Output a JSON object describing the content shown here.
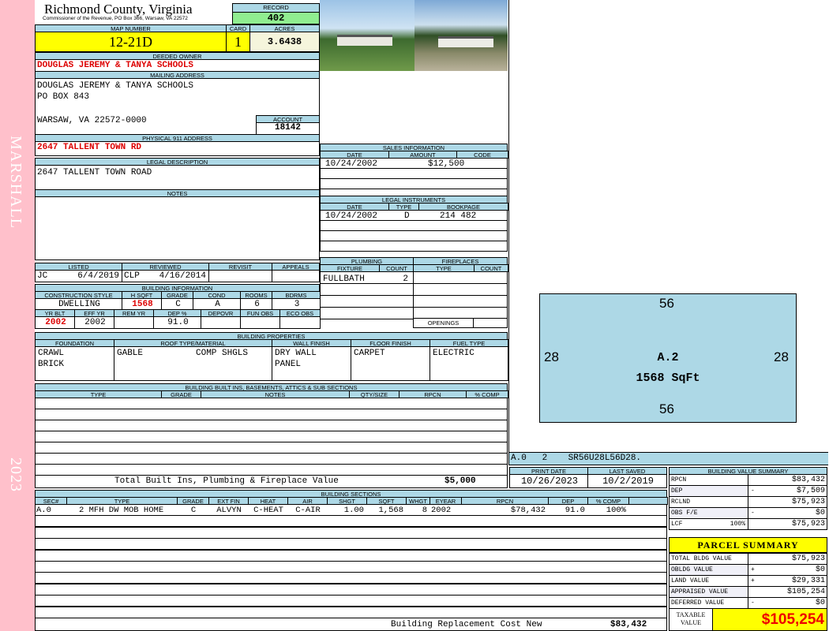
{
  "side": {
    "name": "MARSHALL",
    "year": "2023"
  },
  "header": {
    "county": "Richmond County, Virginia",
    "subtitle": "Commissioner of the Revenue, PO Box 366, Warsaw, VA 22572",
    "record_label": "RECORD",
    "record": "402"
  },
  "map": {
    "map_label": "MAP NUMBER",
    "map": "12-21D",
    "card_label": "CARD",
    "card": "1",
    "acres_label": "ACRES",
    "acres": "3.6438"
  },
  "owner": {
    "label": "DEEDED OWNER",
    "value": "DOUGLAS JEREMY & TANYA SCHOOLS"
  },
  "mailing": {
    "label": "MAILING ADDRESS",
    "line1": "DOUGLAS JEREMY & TANYA SCHOOLS",
    "line2": "PO BOX 843",
    "line3": "WARSAW, VA 22572-0000",
    "account_label": "ACCOUNT",
    "account": "18142"
  },
  "physical": {
    "label": "PHYSICAL 911 ADDRESS",
    "value": "2647 TALLENT TOWN RD"
  },
  "legal": {
    "label": "LEGAL DESCRIPTION",
    "value": "2647 TALLENT TOWN ROAD"
  },
  "notes": {
    "label": "NOTES"
  },
  "review": {
    "listed_label": "LISTED",
    "reviewed_label": "REVIEWED",
    "revisit_label": "REVISIT",
    "appeals_label": "APPEALS",
    "listed_by": "JC",
    "listed_date": "6/4/2019",
    "reviewed_by": "CLP",
    "reviewed_date": "4/16/2014"
  },
  "building_info": {
    "label": "BUILDING INFORMATION",
    "h1": [
      "CONSTRUCTION STYLE",
      "H SQFT",
      "GRADE",
      "COND",
      "ROOMS",
      "BDRMS"
    ],
    "v1": [
      "DWELLING",
      "1568",
      "C",
      "A",
      "6",
      "3"
    ],
    "h2": [
      "YR BLT",
      "EFF YR",
      "REM YR",
      "DEP %",
      "DEPOVR",
      "FUN OBS",
      "ECO OBS"
    ],
    "v2": [
      "2002",
      "2002",
      "",
      "91.0",
      "",
      "",
      ""
    ]
  },
  "sales": {
    "label": "SALES INFORMATION",
    "cols": [
      "DATE",
      "AMOUNT",
      "CODE"
    ],
    "rows": [
      [
        "10/24/2002",
        "$12,500",
        ""
      ]
    ]
  },
  "instruments": {
    "label": "LEGAL INSTRUMENTS",
    "cols": [
      "DATE",
      "TYPE",
      "BOOKPAGE"
    ],
    "rows": [
      [
        "10/24/2002",
        "D",
        "214 482"
      ]
    ]
  },
  "plumbing": {
    "label": "PLUMBING",
    "cols": [
      "FIXTURE",
      "COUNT"
    ],
    "rows": [
      [
        "FULLBATH",
        "2"
      ]
    ]
  },
  "fireplaces": {
    "label": "FIREPLACES",
    "cols": [
      "TYPE",
      "COUNT"
    ],
    "openings": "OPENINGS"
  },
  "properties": {
    "label": "BUILDING PROPERTIES",
    "cols": [
      "FOUNDATION",
      "ROOF TYPE/MATERIAL",
      "WALL FINISH",
      "FLOOR FINISH",
      "FUEL TYPE"
    ],
    "foundation": [
      "CRAWL",
      "BRICK"
    ],
    "roof_type": "GABLE",
    "roof_material": "COMP SHGLS",
    "wall": [
      "DRY WALL",
      "PANEL"
    ],
    "floor": "CARPET",
    "fuel": "ELECTRIC"
  },
  "builtins": {
    "label": "BUILDING BUILT INS, BASEMENTS, ATTICS & SUB SECTIONS",
    "cols": [
      "TYPE",
      "GRADE",
      "NOTES",
      "QTY/SIZE",
      "RPCN",
      "% COMP"
    ],
    "total_label": "Total Built Ins, Plumbing & Fireplace Value",
    "total": "$5,000"
  },
  "sketch": {
    "top": "56",
    "bottom": "56",
    "left": "28",
    "right": "28",
    "label": "A.2",
    "area": "1568 SqFt",
    "fill": "#add8e6",
    "footer": "A.0   2    SR56U28L56D28."
  },
  "dates": {
    "print_label": "PRINT DATE",
    "print": "10/26/2023",
    "saved_label": "LAST SAVED",
    "saved": "10/2/2019"
  },
  "sections": {
    "label": "BUILDING SECTIONS",
    "cols": [
      "SEC#",
      "TYPE",
      "GRADE",
      "EXT FIN",
      "HEAT",
      "AIR",
      "SHGT",
      "SQFT",
      "WHGT",
      "EYEAR",
      "RPCN",
      "DEP",
      "% COMP"
    ],
    "rows": [
      [
        "A.0",
        "2 MFH DW MOB HOME",
        "C",
        "ALVYN",
        "C-HEAT",
        "C-AIR",
        "1.00",
        "1,568",
        "8",
        "2002",
        "$78,432",
        "91.0",
        "100%"
      ]
    ],
    "total_label": "Building Replacement Cost New",
    "total": "$83,432"
  },
  "value_summary": {
    "label": "BUILDING VALUE SUMMARY",
    "rows": [
      [
        "RPCN",
        "",
        "$83,432"
      ],
      [
        "DEP",
        "-",
        "$7,509"
      ],
      [
        "RCLND",
        "",
        "$75,923"
      ],
      [
        "OBS F/E",
        "-",
        "$0"
      ],
      [
        "LCF",
        "100%",
        "$75,923"
      ]
    ]
  },
  "parcel": {
    "label": "PARCEL SUMMARY",
    "rows": [
      [
        "TOTAL BLDG VALUE",
        "",
        "$75,923"
      ],
      [
        "OBLDG VALUE",
        "+",
        "$0"
      ],
      [
        "LAND VALUE",
        "+",
        "$29,331"
      ],
      [
        "APPRAISED VALUE",
        "",
        "$105,254"
      ],
      [
        "DEFERRED VALUE",
        "-",
        "$0"
      ]
    ],
    "taxable_label": "TAXABLE VALUE",
    "taxable": "$105,254"
  }
}
